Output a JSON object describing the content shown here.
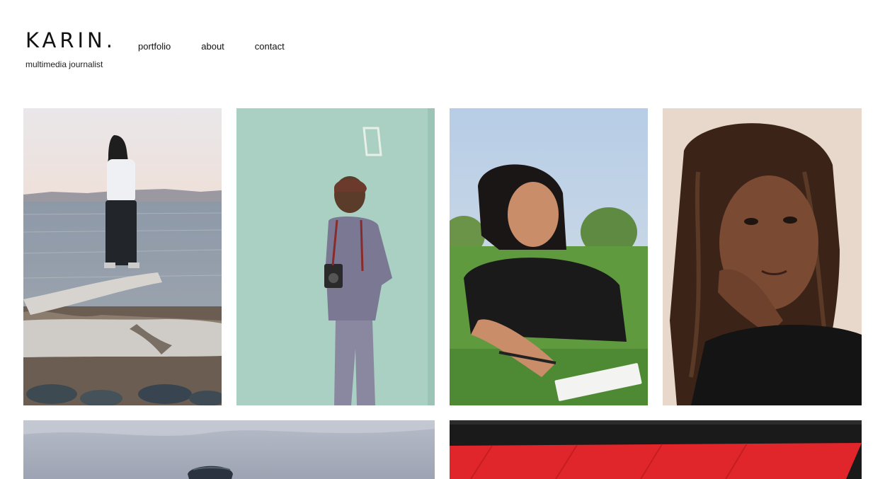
{
  "site": {
    "logo": "KARIN.",
    "tagline": "multimedia journalist"
  },
  "nav": {
    "items": [
      "portfolio",
      "about",
      "contact"
    ]
  },
  "gallery": {
    "photos": [
      {
        "alt": "person with long hair standing on driftwood by the bay"
      },
      {
        "alt": "man in beanie holding twin-lens camera against mint wall"
      },
      {
        "alt": "woman lying on grass writing in notebook"
      },
      {
        "alt": "portrait of woman with braids"
      },
      {
        "alt": "man in cap under cloudy sky"
      },
      {
        "alt": "red and black abstract graphic"
      }
    ]
  },
  "colors": {
    "background": "#ffffff",
    "text": "#111111",
    "mint_wall": "#a9d0c2",
    "accent_red": "#e0262b"
  }
}
